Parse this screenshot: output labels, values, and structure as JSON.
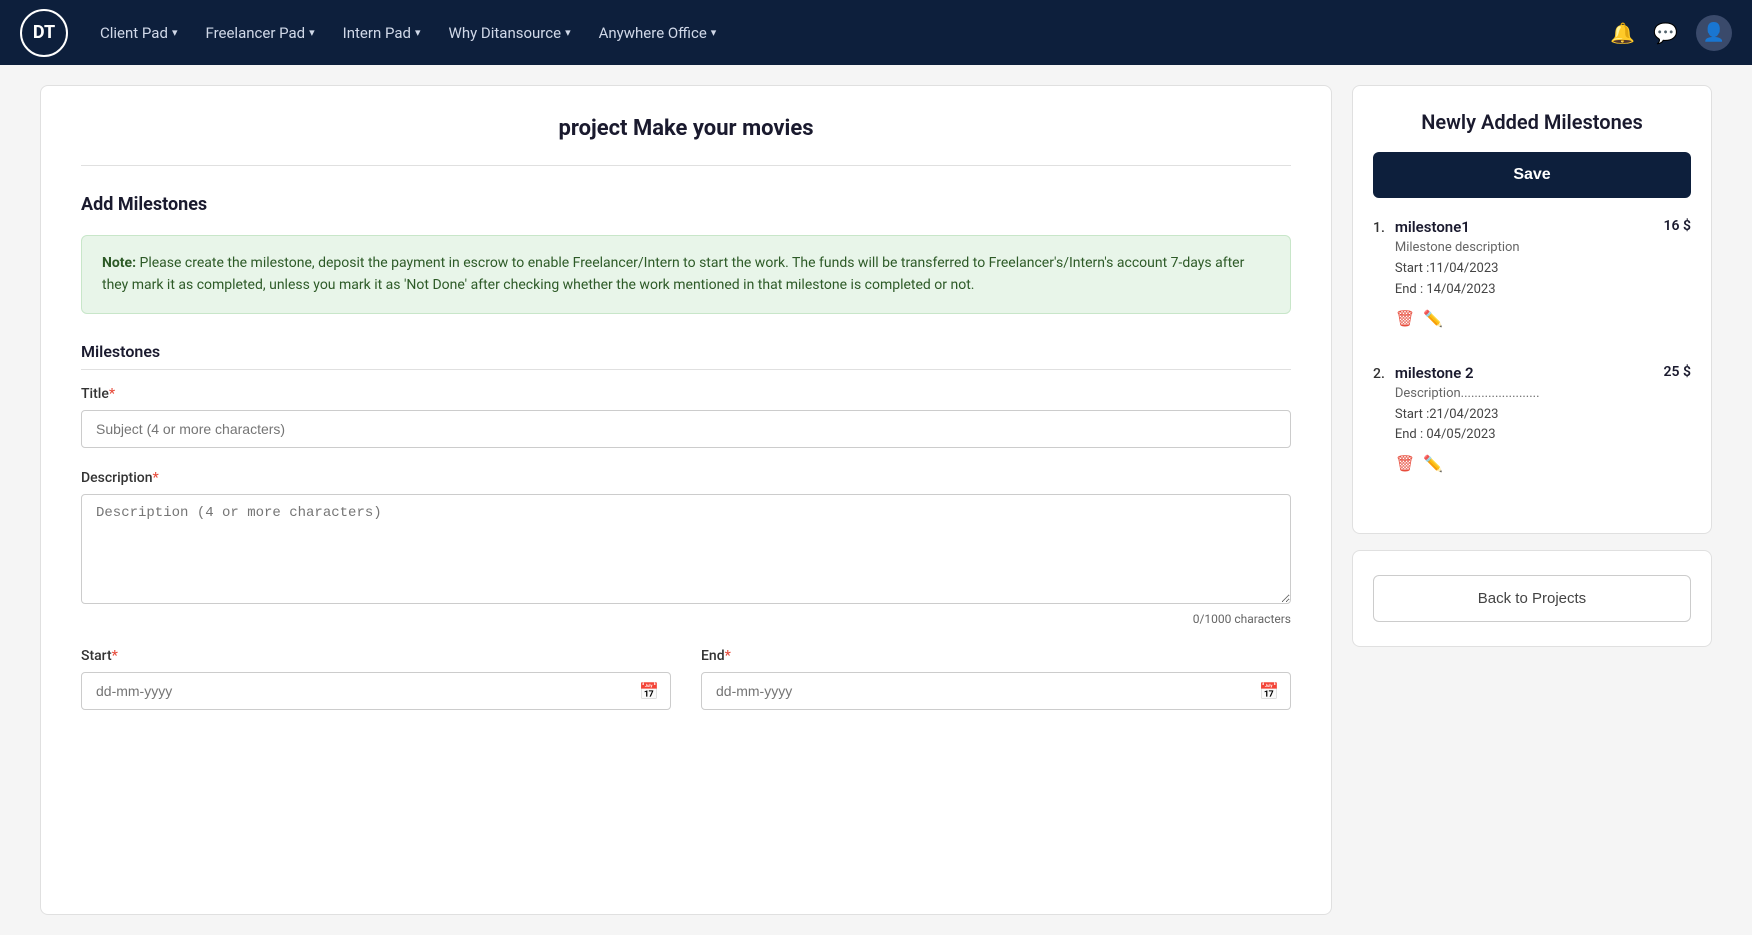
{
  "nav": {
    "logo_text": "DT",
    "links": [
      {
        "label": "Client Pad",
        "id": "client-pad"
      },
      {
        "label": "Freelancer Pad",
        "id": "freelancer-pad"
      },
      {
        "label": "Intern Pad",
        "id": "intern-pad"
      },
      {
        "label": "Why Ditansource",
        "id": "why-ditansource"
      },
      {
        "label": "Anywhere Office",
        "id": "anywhere-office"
      }
    ]
  },
  "page": {
    "project_title": "project Make your movies",
    "add_milestones_heading": "Add Milestones",
    "note_label": "Note:",
    "note_text": "  Please create the milestone, deposit the payment in escrow to enable Freelancer/Intern to start the work. The funds will be transferred to Freelancer's/Intern's account 7-days after they mark it as completed, unless you mark it as 'Not Done' after checking whether the work mentioned in that milestone is completed or not.",
    "milestones_subheading": "Milestones",
    "title_label": "Title",
    "title_placeholder": "Subject (4 or more characters)",
    "description_label": "Description",
    "description_placeholder": "Description (4 or more characters)",
    "char_count": "0/1000 characters",
    "start_label": "Start",
    "start_placeholder": "dd-mm-yyyy",
    "end_label": "End",
    "end_placeholder": "dd-mm-yyyy"
  },
  "sidebar": {
    "panel_title": "Newly Added Milestones",
    "save_button": "Save",
    "milestones": [
      {
        "num": "1.",
        "name": "milestone1",
        "price": "16 $",
        "description": "Milestone description",
        "start": "Start :11/04/2023",
        "end": "End : 14/04/2023"
      },
      {
        "num": "2.",
        "name": "milestone 2",
        "price": "25 $",
        "description": "Description.......................",
        "start": "Start :21/04/2023",
        "end": "End : 04/05/2023"
      }
    ],
    "back_button": "Back to Projects"
  }
}
